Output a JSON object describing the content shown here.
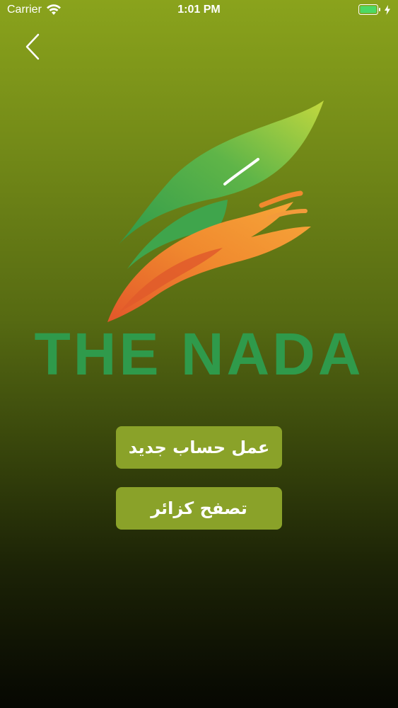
{
  "status_bar": {
    "carrier": "Carrier",
    "time": "1:01 PM",
    "icons": [
      "wifi-icon",
      "battery-icon",
      "charging-bolt-icon"
    ]
  },
  "nav": {
    "back_icon": "chevron-left-icon"
  },
  "logo": {
    "brand_text": "THE NADA",
    "colors": {
      "leaf_green": "#5fb548",
      "leaf_light": "#b6d23b",
      "hand_orange": "#f0892e",
      "hand_dark": "#e3562a",
      "text_green": "#2f9a4b"
    }
  },
  "actions": {
    "create_account_label": "عمل حساب جديد",
    "browse_as_guest_label": "تصفح كزائر"
  },
  "theme": {
    "background_top": "#8aa31c",
    "background_bottom": "#060702",
    "button_color": "#8aa229"
  }
}
